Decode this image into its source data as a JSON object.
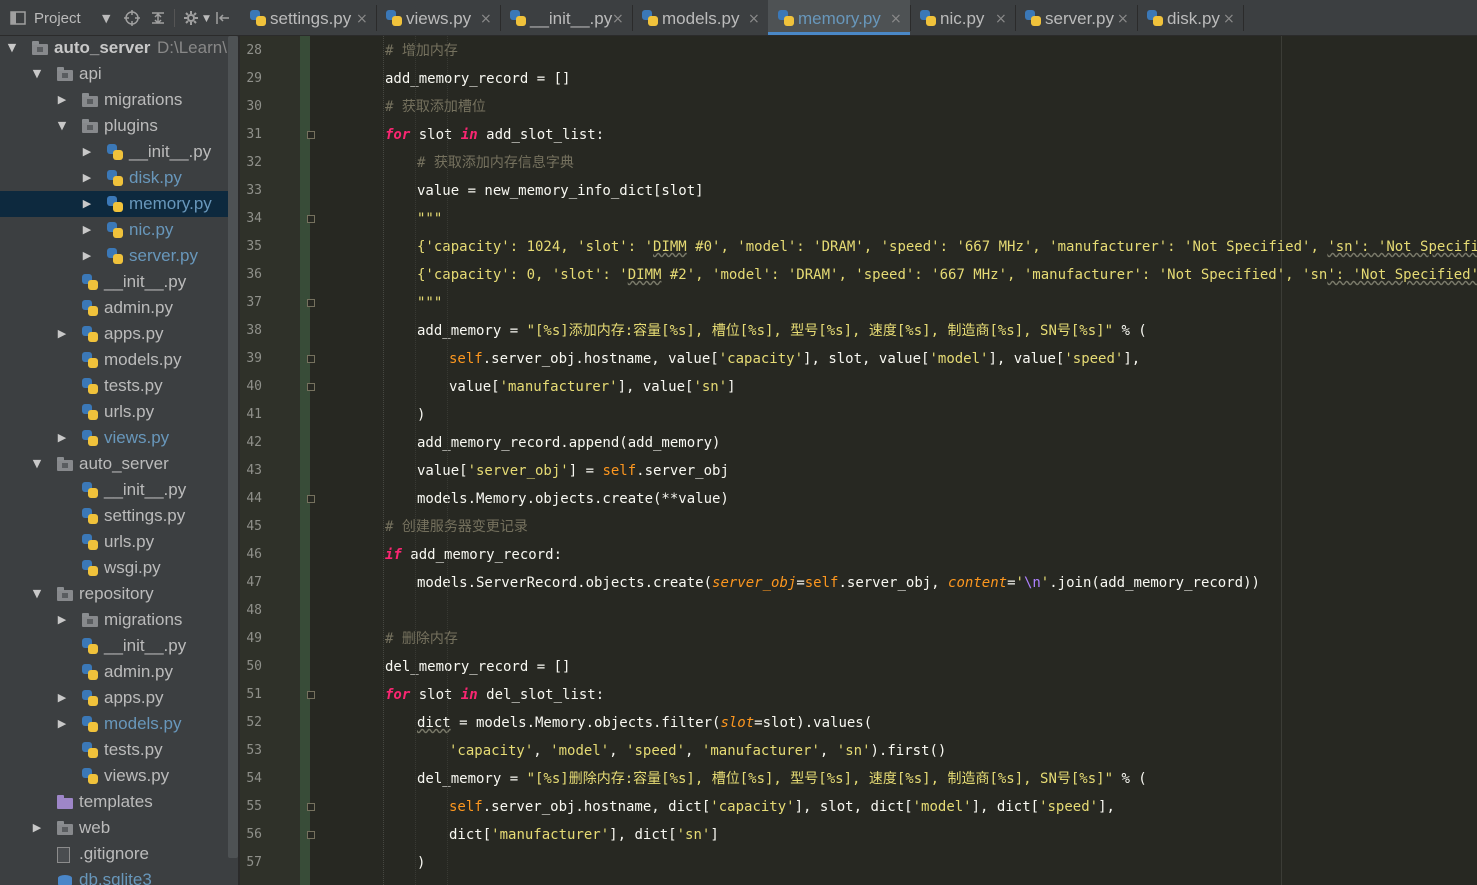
{
  "project_panel": {
    "title": "Project",
    "toolbar_icons": [
      "dropdown-icon",
      "target-icon",
      "collapse-icon",
      "settings-icon",
      "hide-icon"
    ]
  },
  "tree": [
    {
      "label": "auto_server",
      "path": "D:\\Learn\\P",
      "depth": 0,
      "expanded": true,
      "type": "folder",
      "bold": true
    },
    {
      "label": "api",
      "depth": 1,
      "expanded": true,
      "type": "folder"
    },
    {
      "label": "migrations",
      "depth": 2,
      "expanded": false,
      "type": "folder"
    },
    {
      "label": "plugins",
      "depth": 2,
      "expanded": true,
      "type": "folder"
    },
    {
      "label": "__init__.py",
      "depth": 3,
      "expanded": false,
      "type": "py"
    },
    {
      "label": "disk.py",
      "depth": 3,
      "expanded": false,
      "type": "py",
      "blue": true
    },
    {
      "label": "memory.py",
      "depth": 3,
      "expanded": false,
      "type": "py",
      "blue": true,
      "selected": true
    },
    {
      "label": "nic.py",
      "depth": 3,
      "expanded": false,
      "type": "py",
      "blue": true
    },
    {
      "label": "server.py",
      "depth": 3,
      "expanded": false,
      "type": "py",
      "blue": true
    },
    {
      "label": "__init__.py",
      "depth": 2,
      "type": "py"
    },
    {
      "label": "admin.py",
      "depth": 2,
      "type": "py"
    },
    {
      "label": "apps.py",
      "depth": 2,
      "expanded": false,
      "type": "py"
    },
    {
      "label": "models.py",
      "depth": 2,
      "type": "py"
    },
    {
      "label": "tests.py",
      "depth": 2,
      "type": "py"
    },
    {
      "label": "urls.py",
      "depth": 2,
      "type": "py"
    },
    {
      "label": "views.py",
      "depth": 2,
      "expanded": false,
      "type": "py",
      "blue": true
    },
    {
      "label": "auto_server",
      "depth": 1,
      "expanded": true,
      "type": "folder"
    },
    {
      "label": "__init__.py",
      "depth": 2,
      "type": "py"
    },
    {
      "label": "settings.py",
      "depth": 2,
      "type": "py"
    },
    {
      "label": "urls.py",
      "depth": 2,
      "type": "py"
    },
    {
      "label": "wsgi.py",
      "depth": 2,
      "type": "py"
    },
    {
      "label": "repository",
      "depth": 1,
      "expanded": true,
      "type": "folder"
    },
    {
      "label": "migrations",
      "depth": 2,
      "expanded": false,
      "type": "folder"
    },
    {
      "label": "__init__.py",
      "depth": 2,
      "type": "py"
    },
    {
      "label": "admin.py",
      "depth": 2,
      "type": "py"
    },
    {
      "label": "apps.py",
      "depth": 2,
      "expanded": false,
      "type": "py"
    },
    {
      "label": "models.py",
      "depth": 2,
      "expanded": false,
      "type": "py",
      "blue": true
    },
    {
      "label": "tests.py",
      "depth": 2,
      "type": "py"
    },
    {
      "label": "views.py",
      "depth": 2,
      "type": "py"
    },
    {
      "label": "templates",
      "depth": 1,
      "type": "tpl"
    },
    {
      "label": "web",
      "depth": 1,
      "expanded": false,
      "type": "folder"
    },
    {
      "label": ".gitignore",
      "depth": 1,
      "type": "file"
    },
    {
      "label": "db.sqlite3",
      "depth": 1,
      "type": "db",
      "blue": true
    }
  ],
  "tabs": [
    {
      "label": "settings.py",
      "active": false
    },
    {
      "label": "views.py",
      "active": false
    },
    {
      "label": "__init__.py",
      "active": false
    },
    {
      "label": "models.py",
      "active": false
    },
    {
      "label": "memory.py",
      "active": true
    },
    {
      "label": "nic.py",
      "active": false
    },
    {
      "label": "server.py",
      "active": false
    },
    {
      "label": "disk.py",
      "active": false
    }
  ],
  "tab_close_glyph": "×",
  "code": [
    {
      "n": "28",
      "indent": 1,
      "t": [
        [
          "c-cm",
          "# 增加内存"
        ]
      ]
    },
    {
      "n": "29",
      "indent": 1,
      "t": [
        [
          "c-pl",
          "add_memory_record = []"
        ]
      ]
    },
    {
      "n": "30",
      "indent": 1,
      "t": [
        [
          "c-cm",
          "# 获取添加槽位"
        ]
      ]
    },
    {
      "n": "31",
      "indent": 1,
      "fold": true,
      "t": [
        [
          "c-kw",
          "for"
        ],
        [
          "c-pl",
          " slot "
        ],
        [
          "c-kw",
          "in"
        ],
        [
          "c-pl",
          " add_slot_list:"
        ]
      ]
    },
    {
      "n": "32",
      "indent": 2,
      "t": [
        [
          "c-cm",
          "# 获取添加内存信息字典"
        ]
      ]
    },
    {
      "n": "33",
      "indent": 2,
      "t": [
        [
          "c-pl",
          "value = new_memory_info_dict[slot]"
        ]
      ]
    },
    {
      "n": "34",
      "indent": 2,
      "fold": true,
      "t": [
        [
          "c-st",
          "\"\"\""
        ]
      ]
    },
    {
      "n": "35",
      "indent": 2,
      "t": [
        [
          "c-st",
          "{'capacity': 1024, 'slot': '"
        ],
        [
          "c-st c-wv",
          "DIMM"
        ],
        [
          "c-st",
          " #0', 'model': 'DRAM', 'speed': '667 MHz', 'manufacturer': 'Not Specified', "
        ],
        [
          "c-st c-wv",
          "'sn': 'Not Specified'}"
        ]
      ]
    },
    {
      "n": "36",
      "indent": 2,
      "t": [
        [
          "c-st",
          "{'capacity': 0, 'slot': '"
        ],
        [
          "c-st c-wv",
          "DIMM"
        ],
        [
          "c-st",
          " #2', 'model': 'DRAM', 'speed': '667 MHz', 'manufacturer': 'Not Specified', 'sn"
        ],
        [
          "c-st c-wv",
          "': 'Not Specified'}"
        ]
      ]
    },
    {
      "n": "37",
      "indent": 2,
      "fold": true,
      "t": [
        [
          "c-st",
          "\"\"\""
        ]
      ]
    },
    {
      "n": "38",
      "indent": 2,
      "t": [
        [
          "c-pl",
          "add_memory = "
        ],
        [
          "c-st",
          "\"[%s]添加内存:容量[%s], 槽位[%s], 型号[%s], 速度[%s], 制造商[%s], SN号[%s]\""
        ],
        [
          "c-pl",
          " % ("
        ]
      ]
    },
    {
      "n": "39",
      "indent": 3,
      "fold": true,
      "t": [
        [
          "c-sf",
          "self"
        ],
        [
          "c-pl",
          ".server_obj.hostname, value["
        ],
        [
          "c-st",
          "'capacity'"
        ],
        [
          "c-pl",
          "], slot, value["
        ],
        [
          "c-st",
          "'model'"
        ],
        [
          "c-pl",
          "], value["
        ],
        [
          "c-st",
          "'speed'"
        ],
        [
          "c-pl",
          "],"
        ]
      ]
    },
    {
      "n": "40",
      "indent": 3,
      "fold": true,
      "t": [
        [
          "c-pl",
          "value["
        ],
        [
          "c-st",
          "'manufacturer'"
        ],
        [
          "c-pl",
          "], value["
        ],
        [
          "c-st",
          "'sn'"
        ],
        [
          "c-pl",
          "]"
        ]
      ]
    },
    {
      "n": "41",
      "indent": 2,
      "t": [
        [
          "c-pl",
          ")"
        ]
      ]
    },
    {
      "n": "42",
      "indent": 2,
      "t": [
        [
          "c-pl",
          "add_memory_record.append(add_memory)"
        ]
      ]
    },
    {
      "n": "43",
      "indent": 2,
      "t": [
        [
          "c-pl",
          "value["
        ],
        [
          "c-st",
          "'server_obj'"
        ],
        [
          "c-pl",
          "] = "
        ],
        [
          "c-sf",
          "self"
        ],
        [
          "c-pl",
          ".server_obj"
        ]
      ]
    },
    {
      "n": "44",
      "indent": 2,
      "fold": true,
      "t": [
        [
          "c-pl",
          "models.Memory.objects.create(**value)"
        ]
      ]
    },
    {
      "n": "45",
      "indent": 1,
      "t": [
        [
          "c-cm",
          "# 创建服务器变更记录"
        ]
      ]
    },
    {
      "n": "46",
      "indent": 1,
      "t": [
        [
          "c-kw",
          "if"
        ],
        [
          "c-pl",
          " add_memory_record:"
        ]
      ]
    },
    {
      "n": "47",
      "indent": 2,
      "t": [
        [
          "c-pl",
          "models.ServerRecord.objects.create("
        ],
        [
          "c-kwarg",
          "server_obj"
        ],
        [
          "c-pl",
          "="
        ],
        [
          "c-sf",
          "self"
        ],
        [
          "c-pl",
          ".server_obj, "
        ],
        [
          "c-kwarg",
          "content"
        ],
        [
          "c-pl",
          "="
        ],
        [
          "c-st",
          "'"
        ],
        [
          "c-esc",
          "\\n"
        ],
        [
          "c-st",
          "'"
        ],
        [
          "c-pl",
          ".join(add_memory_record))"
        ]
      ]
    },
    {
      "n": "48",
      "indent": 0,
      "t": []
    },
    {
      "n": "49",
      "indent": 1,
      "t": [
        [
          "c-cm",
          "# 删除内存"
        ]
      ]
    },
    {
      "n": "50",
      "indent": 1,
      "t": [
        [
          "c-pl",
          "del_memory_record = []"
        ]
      ]
    },
    {
      "n": "51",
      "indent": 1,
      "fold": true,
      "t": [
        [
          "c-kw",
          "for"
        ],
        [
          "c-pl",
          " slot "
        ],
        [
          "c-kw",
          "in"
        ],
        [
          "c-pl",
          " del_slot_list:"
        ]
      ]
    },
    {
      "n": "52",
      "indent": 2,
      "t": [
        [
          "c-dk",
          "dict"
        ],
        [
          "c-pl",
          " = models.Memory.objects.filter("
        ],
        [
          "c-kwarg",
          "slot"
        ],
        [
          "c-pl",
          "=slot).values("
        ]
      ]
    },
    {
      "n": "53",
      "indent": 3,
      "t": [
        [
          "c-st",
          "'capacity'"
        ],
        [
          "c-pl",
          ", "
        ],
        [
          "c-st",
          "'model'"
        ],
        [
          "c-pl",
          ", "
        ],
        [
          "c-st",
          "'speed'"
        ],
        [
          "c-pl",
          ", "
        ],
        [
          "c-st",
          "'manufacturer'"
        ],
        [
          "c-pl",
          ", "
        ],
        [
          "c-st",
          "'sn'"
        ],
        [
          "c-pl",
          ").first()"
        ]
      ]
    },
    {
      "n": "54",
      "indent": 2,
      "t": [
        [
          "c-pl",
          "del_memory = "
        ],
        [
          "c-st",
          "\"[%s]删除内存:容量[%s], 槽位[%s], 型号[%s], 速度[%s], 制造商[%s], SN号[%s]\""
        ],
        [
          "c-pl",
          " % ("
        ]
      ]
    },
    {
      "n": "55",
      "indent": 3,
      "fold": true,
      "t": [
        [
          "c-sf",
          "self"
        ],
        [
          "c-pl",
          ".server_obj.hostname, dict["
        ],
        [
          "c-st",
          "'capacity'"
        ],
        [
          "c-pl",
          "], slot, dict["
        ],
        [
          "c-st",
          "'model'"
        ],
        [
          "c-pl",
          "], dict["
        ],
        [
          "c-st",
          "'speed'"
        ],
        [
          "c-pl",
          "],"
        ]
      ]
    },
    {
      "n": "56",
      "indent": 3,
      "fold": true,
      "t": [
        [
          "c-pl",
          "dict["
        ],
        [
          "c-st",
          "'manufacturer'"
        ],
        [
          "c-pl",
          "], dict["
        ],
        [
          "c-st",
          "'sn'"
        ],
        [
          "c-pl",
          "]"
        ]
      ]
    },
    {
      "n": "57",
      "indent": 2,
      "t": [
        [
          "c-pl",
          ")"
        ]
      ]
    }
  ],
  "colors": {
    "editor_bg": "#272822",
    "sidebar_bg": "#3c3f41",
    "selection": "#0d293e",
    "comment": "#75715e",
    "keyword": "#f92672",
    "string": "#e6db74",
    "self": "#fd971f"
  }
}
